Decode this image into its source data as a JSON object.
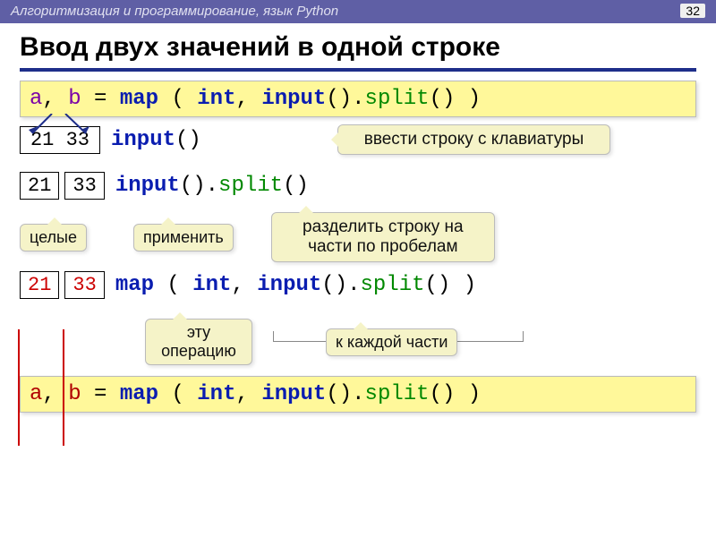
{
  "header": {
    "breadcrumb": "Алгоритмизация и программирование, язык Python",
    "page": "32"
  },
  "title": "Ввод двух значений в одной строке",
  "code": {
    "a": "a",
    "b": "b",
    "comma_sp": ", ",
    "eq": " = ",
    "map": "map",
    "open": " ( ",
    "open2": "(",
    "close": " )",
    "close2": ")",
    "int": "int",
    "input": "input",
    "dot": ".",
    "split": "split",
    "empty_parens": "()",
    "comma": ", "
  },
  "row1": {
    "box": "21 33",
    "code_label": "input()"
  },
  "row2": {
    "box_a": "21",
    "box_b": "33"
  },
  "row3": {
    "box_a": "21",
    "box_b": "33"
  },
  "callouts": {
    "enter_keyboard": "ввести строку с клавиатуры",
    "split_spaces": "разделить строку на части по пробелам",
    "apply": "применить",
    "integers": "целые",
    "this_op": "эту операцию",
    "to_each": "к каждой части"
  }
}
